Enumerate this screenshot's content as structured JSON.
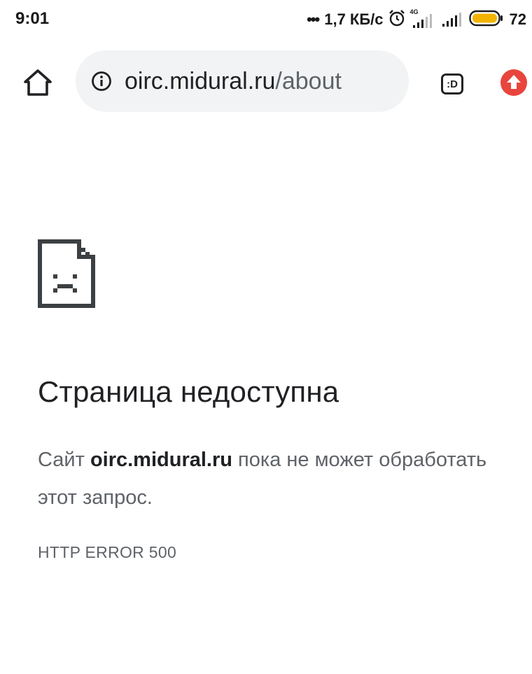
{
  "status_bar": {
    "time": "9:01",
    "dots": "•••",
    "net_speed": "1,7 КБ/с",
    "network_type": "4G",
    "battery_percent": "72",
    "battery_color": "#f2b400",
    "icons": [
      "alarm-icon",
      "signal-icon",
      "signal-icon",
      "battery-icon"
    ]
  },
  "toolbar": {
    "url_host": "oirc.midural.ru",
    "url_path": "/about",
    "tab_label": ":D",
    "update_color": "#e8453c",
    "icons": [
      "home-icon",
      "info-icon",
      "tab-switcher-icon",
      "update-arrow-icon"
    ]
  },
  "error": {
    "title": "Страница недоступна",
    "message_prefix": "Сайт ",
    "message_host": "oirc.midural.ru",
    "message_suffix": " пока не может обработать этот запрос.",
    "code": "HTTP ERROR 500",
    "icon": "sad-page-icon"
  }
}
